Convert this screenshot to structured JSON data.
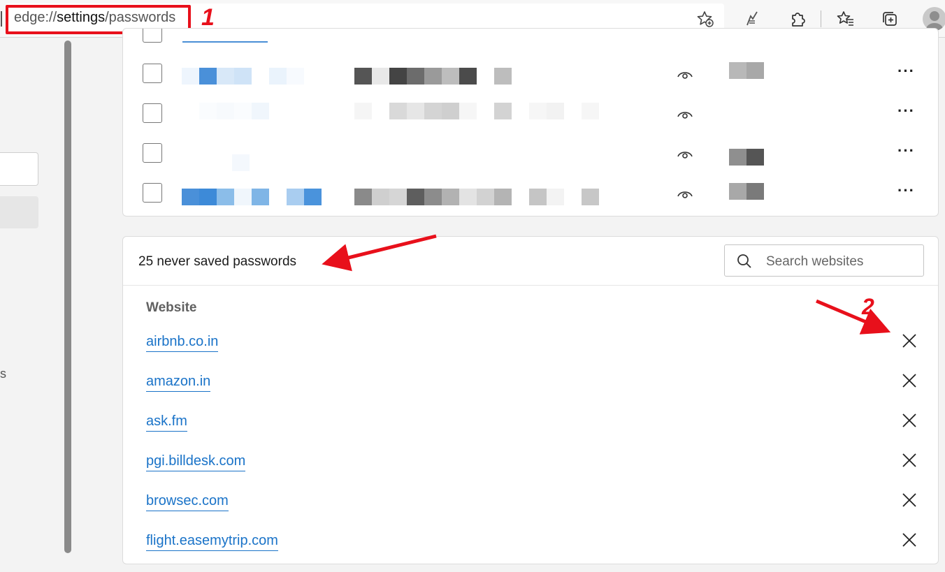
{
  "browser": {
    "address_prefix": "edge://",
    "address_strong": "settings",
    "address_suffix": "/passwords",
    "icons": [
      "add-favorite-icon",
      "read-aloud-icon",
      "extensions-icon",
      "favorites-icon",
      "collections-icon",
      "profile-avatar"
    ]
  },
  "annotations": {
    "step1_label": "1",
    "step2_label": "2",
    "color": "#e8101b"
  },
  "sidebar": {
    "partial_text": "s"
  },
  "saved_passwords": {
    "rows": [
      {
        "id": 1
      },
      {
        "id": 2
      },
      {
        "id": 3
      },
      {
        "id": 4
      }
    ]
  },
  "never_saved": {
    "title": "25 never saved passwords",
    "search_placeholder": "Search websites",
    "column_header": "Website",
    "sites": [
      "airbnb.co.in",
      "amazon.in",
      "ask.fm",
      "pgi.billdesk.com",
      "browsec.com",
      "flight.easemytrip.com"
    ]
  },
  "colors": {
    "link": "#1a73c8",
    "annotation_red": "#e8101b"
  }
}
